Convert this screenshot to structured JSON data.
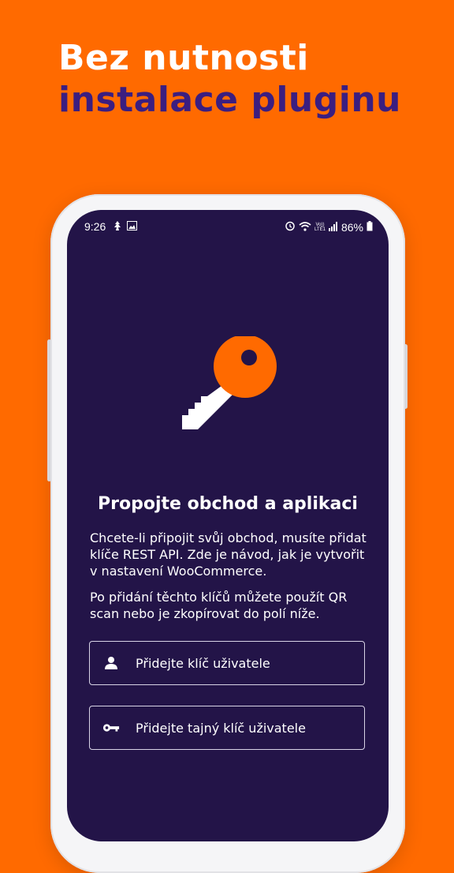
{
  "headline": {
    "line1": "Bez nutnosti",
    "line2": "instalace pluginu"
  },
  "status_bar": {
    "time": "9:26",
    "battery": "86%",
    "network_label": "Vo)) LTE1"
  },
  "connect": {
    "title": "Propojte obchod a aplikaci",
    "description_1": "Chcete-li připojit svůj obchod, musíte přidat klíče REST API. Zde je návod, jak je vytvořit v nastavení WooCommerce.",
    "description_2": "Po přidání těchto klíčů můžete použít QR scan nebo je zkopírovat do polí níže."
  },
  "fields": {
    "consumer_key_placeholder": "Přidejte klíč uživatele",
    "consumer_secret_placeholder": "Přidejte tajný klíč uživatele"
  },
  "icons": [
    "person-icon",
    "key-icon",
    "alarm-icon",
    "wifi-icon",
    "signal-icon",
    "battery-icon",
    "image-icon",
    "notification-icon"
  ],
  "colors": {
    "background": "#FF6A00",
    "screen": "#231448",
    "accent_purple": "#3B1E80",
    "key_orange": "#FF6A00"
  }
}
